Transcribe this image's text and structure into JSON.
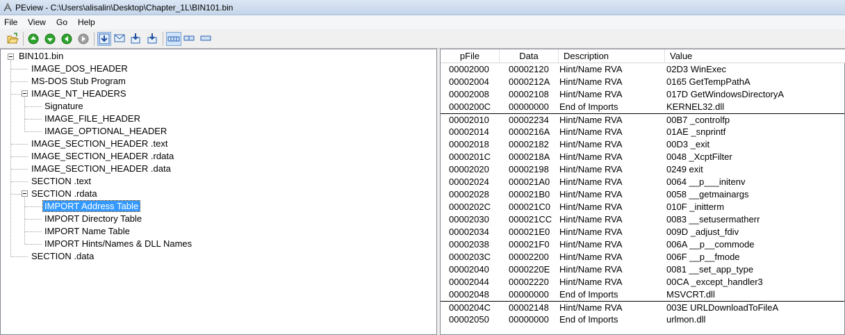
{
  "window": {
    "title": "PEview - C:\\Users\\alisalin\\Desktop\\Chapter_1L\\BIN101.bin"
  },
  "menu": [
    "File",
    "View",
    "Go",
    "Help"
  ],
  "toolbar": {
    "buttons": [
      {
        "icon": "open-file-icon"
      },
      {
        "icon": "back-green-icon"
      },
      {
        "icon": "up-green-icon"
      },
      {
        "icon": "forward-green-icon"
      },
      {
        "icon": "forward-gray-icon"
      },
      {
        "icon": "view-down-arrow-icon",
        "pressed": true
      },
      {
        "icon": "view-envelope-icon"
      },
      {
        "icon": "view-down-left-icon"
      },
      {
        "icon": "view-down-right-icon"
      },
      {
        "icon": "byte-view-icon",
        "pressed": true
      },
      {
        "icon": "word-view-icon"
      },
      {
        "icon": "dword-view-icon"
      }
    ]
  },
  "tree": {
    "root": "BIN101.bin",
    "items": [
      {
        "label": "IMAGE_DOS_HEADER",
        "level": 1
      },
      {
        "label": "MS-DOS Stub Program",
        "level": 1
      },
      {
        "label": "IMAGE_NT_HEADERS",
        "level": 1,
        "expanded": true
      },
      {
        "label": "Signature",
        "level": 2
      },
      {
        "label": "IMAGE_FILE_HEADER",
        "level": 2
      },
      {
        "label": "IMAGE_OPTIONAL_HEADER",
        "level": 2
      },
      {
        "label": "IMAGE_SECTION_HEADER .text",
        "level": 1
      },
      {
        "label": "IMAGE_SECTION_HEADER .rdata",
        "level": 1
      },
      {
        "label": "IMAGE_SECTION_HEADER .data",
        "level": 1
      },
      {
        "label": "SECTION .text",
        "level": 1
      },
      {
        "label": "SECTION .rdata",
        "level": 1,
        "expanded": true
      },
      {
        "label": "IMPORT Address Table",
        "level": 2,
        "selected": true
      },
      {
        "label": "IMPORT Directory Table",
        "level": 2
      },
      {
        "label": "IMPORT Name Table",
        "level": 2
      },
      {
        "label": "IMPORT Hints/Names & DLL Names",
        "level": 2
      },
      {
        "label": "SECTION .data",
        "level": 1
      }
    ]
  },
  "list": {
    "columns": [
      "pFile",
      "Data",
      "Description",
      "Value"
    ],
    "rows": [
      {
        "pfile": "00002000",
        "data": "00002120",
        "desc": "Hint/Name RVA",
        "value": "02D3  WinExec",
        "group_start": false
      },
      {
        "pfile": "00002004",
        "data": "0000212A",
        "desc": "Hint/Name RVA",
        "value": "0165  GetTempPathA",
        "group_start": false
      },
      {
        "pfile": "00002008",
        "data": "00002108",
        "desc": "Hint/Name RVA",
        "value": "017D  GetWindowsDirectoryA",
        "group_start": false
      },
      {
        "pfile": "0000200C",
        "data": "00000000",
        "desc": "End of Imports",
        "value": "KERNEL32.dll",
        "group_start": false
      },
      {
        "pfile": "00002010",
        "data": "00002234",
        "desc": "Hint/Name RVA",
        "value": "00B7  _controlfp",
        "group_start": true
      },
      {
        "pfile": "00002014",
        "data": "0000216A",
        "desc": "Hint/Name RVA",
        "value": "01AE  _snprintf",
        "group_start": false
      },
      {
        "pfile": "00002018",
        "data": "00002182",
        "desc": "Hint/Name RVA",
        "value": "00D3  _exit",
        "group_start": false
      },
      {
        "pfile": "0000201C",
        "data": "0000218A",
        "desc": "Hint/Name RVA",
        "value": "0048  _XcptFilter",
        "group_start": false
      },
      {
        "pfile": "00002020",
        "data": "00002198",
        "desc": "Hint/Name RVA",
        "value": "0249  exit",
        "group_start": false
      },
      {
        "pfile": "00002024",
        "data": "000021A0",
        "desc": "Hint/Name RVA",
        "value": "0064  __p___initenv",
        "group_start": false
      },
      {
        "pfile": "00002028",
        "data": "000021B0",
        "desc": "Hint/Name RVA",
        "value": "0058  __getmainargs",
        "group_start": false
      },
      {
        "pfile": "0000202C",
        "data": "000021C0",
        "desc": "Hint/Name RVA",
        "value": "010F  _initterm",
        "group_start": false
      },
      {
        "pfile": "00002030",
        "data": "000021CC",
        "desc": "Hint/Name RVA",
        "value": "0083  __setusermatherr",
        "group_start": false
      },
      {
        "pfile": "00002034",
        "data": "000021E0",
        "desc": "Hint/Name RVA",
        "value": "009D  _adjust_fdiv",
        "group_start": false
      },
      {
        "pfile": "00002038",
        "data": "000021F0",
        "desc": "Hint/Name RVA",
        "value": "006A  __p__commode",
        "group_start": false
      },
      {
        "pfile": "0000203C",
        "data": "00002200",
        "desc": "Hint/Name RVA",
        "value": "006F  __p__fmode",
        "group_start": false
      },
      {
        "pfile": "00002040",
        "data": "0000220E",
        "desc": "Hint/Name RVA",
        "value": "0081  __set_app_type",
        "group_start": false
      },
      {
        "pfile": "00002044",
        "data": "00002220",
        "desc": "Hint/Name RVA",
        "value": "00CA  _except_handler3",
        "group_start": false
      },
      {
        "pfile": "00002048",
        "data": "00000000",
        "desc": "End of Imports",
        "value": "MSVCRT.dll",
        "group_start": false
      },
      {
        "pfile": "0000204C",
        "data": "00002148",
        "desc": "Hint/Name RVA",
        "value": "003E  URLDownloadToFileA",
        "group_start": true
      },
      {
        "pfile": "00002050",
        "data": "00000000",
        "desc": "End of Imports",
        "value": "urlmon.dll",
        "group_start": false
      }
    ]
  },
  "colors": {
    "selection": "#3399ff",
    "title_gradient_top": "#dbe6f4",
    "green_button": "#2ea52e"
  }
}
